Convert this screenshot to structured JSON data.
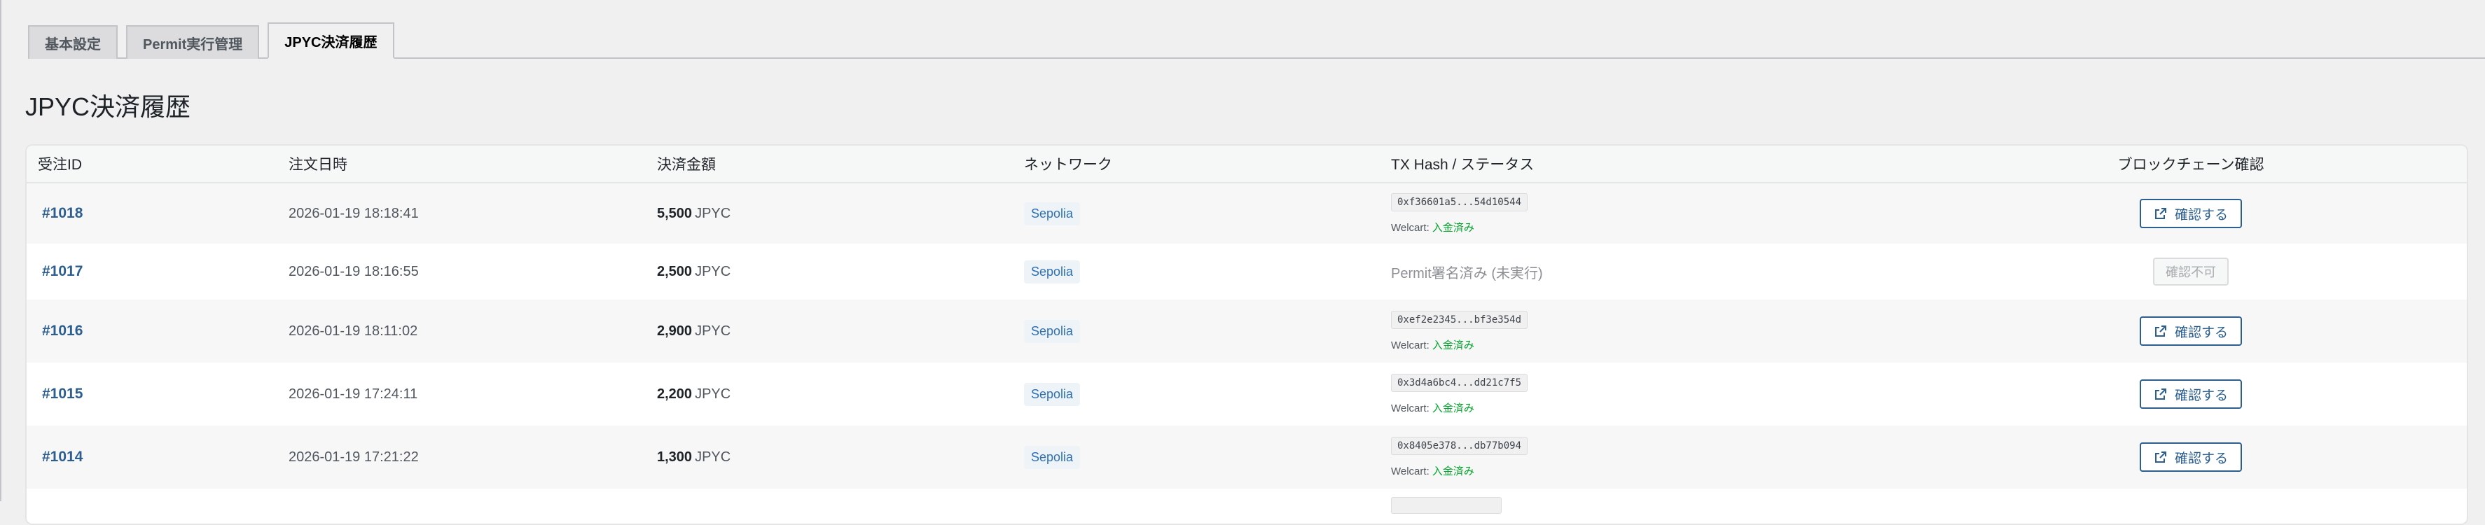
{
  "tabs": [
    "基本設定",
    "Permit実行管理",
    "JPYC決済履歴"
  ],
  "page_title": "JPYC決済履歴",
  "columns": [
    "受注ID",
    "注文日時",
    "決済金額",
    "ネットワーク",
    "TX Hash / ステータス",
    "ブロックチェーン確認"
  ],
  "rows": [
    {
      "order_id": "#1018",
      "date": "2026-01-19 18:18:41",
      "amount": "5,500",
      "unit": "JPYC",
      "network": "Sepolia",
      "tx_hash": "0xf36601a5...54d10544",
      "welcart_label": "Welcart: ",
      "welcart_status": "入金済み",
      "action": "確認する"
    },
    {
      "order_id": "#1017",
      "date": "2026-01-19 18:16:55",
      "amount": "2,500",
      "unit": "JPYC",
      "network": "Sepolia",
      "status_text": "Permit署名済み (未実行)",
      "action_disabled": "確認不可"
    },
    {
      "order_id": "#1016",
      "date": "2026-01-19 18:11:02",
      "amount": "2,900",
      "unit": "JPYC",
      "network": "Sepolia",
      "tx_hash": "0xef2e2345...bf3e354d",
      "welcart_label": "Welcart: ",
      "welcart_status": "入金済み",
      "action": "確認する"
    },
    {
      "order_id": "#1015",
      "date": "2026-01-19 17:24:11",
      "amount": "2,200",
      "unit": "JPYC",
      "network": "Sepolia",
      "tx_hash": "0x3d4a6bc4...dd21c7f5",
      "welcart_label": "Welcart: ",
      "welcart_status": "入金済み",
      "action": "確認する"
    },
    {
      "order_id": "#1014",
      "date": "2026-01-19 17:21:22",
      "amount": "1,300",
      "unit": "JPYC",
      "network": "Sepolia",
      "tx_hash": "0x8405e378...db77b094",
      "welcart_label": "Welcart: ",
      "welcart_status": "入金済み",
      "action": "確認する"
    }
  ],
  "colors": {
    "link": "#2c5f8f",
    "paid": "#00a32a",
    "network_badge": "#2c6fb5"
  },
  "icons": {
    "confirm_button": "external-link-icon"
  }
}
